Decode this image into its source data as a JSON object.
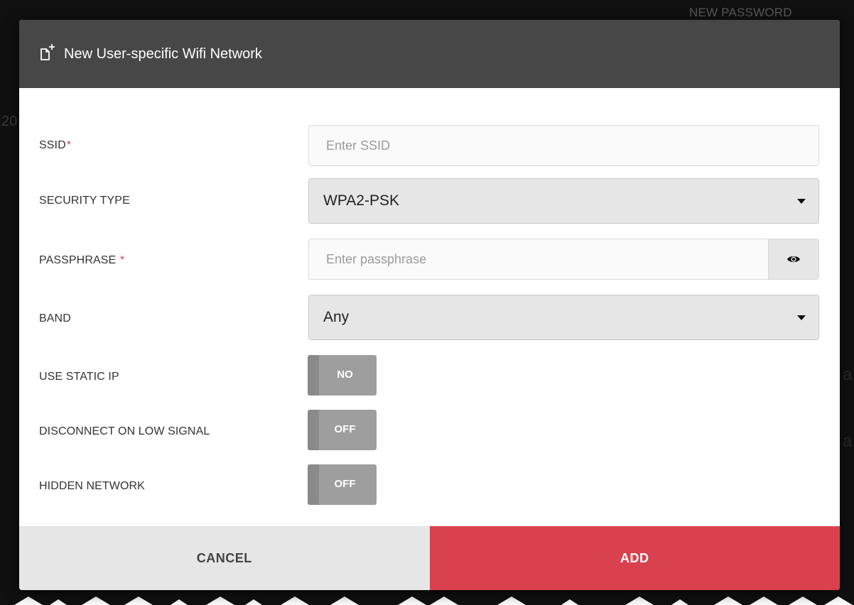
{
  "background": {
    "field_label": "NEW PASSWORD",
    "fragment_left": "20",
    "fragment_right_1": "a",
    "fragment_right_2": "a"
  },
  "dialog": {
    "title": "New User-specific Wifi Network",
    "header_icon": "new-file-icon",
    "fields": {
      "ssid": {
        "label": "SSID",
        "required_mark": "*",
        "placeholder": "Enter SSID",
        "value": ""
      },
      "security_type": {
        "label": "SECURITY TYPE",
        "value": "WPA2-PSK"
      },
      "passphrase": {
        "label": "PASSPHRASE ",
        "required_mark": "*",
        "placeholder": "Enter passphrase",
        "value": "",
        "reveal_icon": "eye-icon"
      },
      "band": {
        "label": "BAND",
        "value": "Any"
      },
      "use_static_ip": {
        "label": "USE STATIC IP",
        "state": "NO"
      },
      "disconnect_low_signal": {
        "label": "DISCONNECT ON LOW SIGNAL",
        "state": "OFF"
      },
      "hidden_network": {
        "label": "HIDDEN NETWORK",
        "state": "OFF"
      }
    },
    "footer": {
      "cancel_label": "CANCEL",
      "add_label": "ADD"
    }
  },
  "colors": {
    "header_bg": "#474747",
    "accent": "#d9414e",
    "toggle_off": "#9e9e9e"
  }
}
